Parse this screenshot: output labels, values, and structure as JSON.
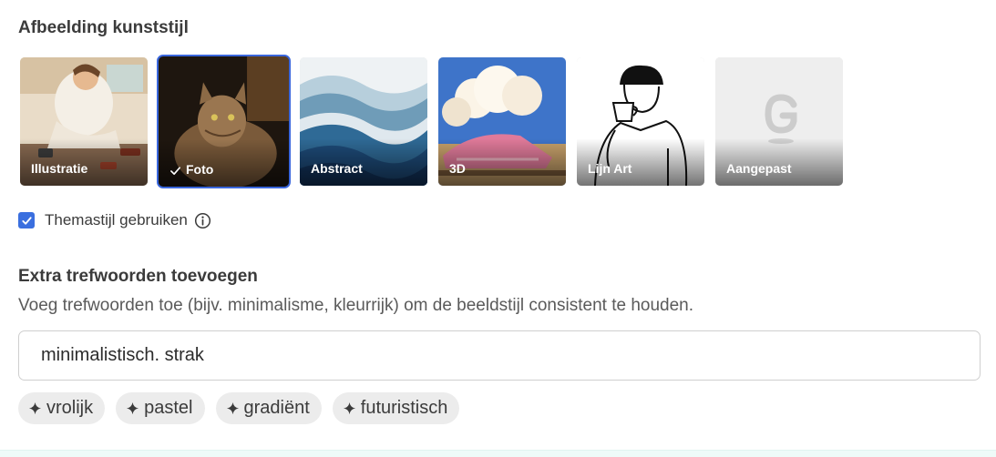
{
  "section": {
    "title": "Afbeelding kunststijl"
  },
  "styles": [
    {
      "label": "Illustratie",
      "selected": false
    },
    {
      "label": "Foto",
      "selected": true
    },
    {
      "label": "Abstract",
      "selected": false
    },
    {
      "label": "3D",
      "selected": false
    },
    {
      "label": "Lijn Art",
      "selected": false
    },
    {
      "label": "Aangepast",
      "selected": false
    }
  ],
  "theme": {
    "label": "Themastijl gebruiken",
    "checked": true
  },
  "keywords": {
    "title": "Extra trefwoorden toevoegen",
    "description": "Voeg trefwoorden toe (bijv. minimalisme, kleurrijk) om de beeldstijl consistent te houden.",
    "input_value": "minimalistisch. strak",
    "suggestions": [
      "vrolijk",
      "pastel",
      "gradiënt",
      "futuristisch"
    ]
  },
  "colors": {
    "accent": "#3a67dd",
    "chip_bg": "#ececec"
  }
}
